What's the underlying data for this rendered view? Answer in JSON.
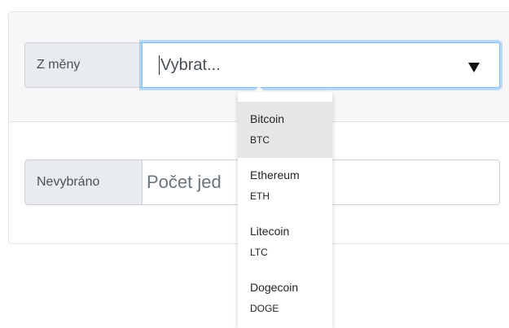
{
  "from_currency": {
    "label": "Z měny",
    "select_value": "Vybrat..."
  },
  "amount": {
    "label": "Nevybráno",
    "placeholder_visible": "Počet jed"
  },
  "dropdown": {
    "options": [
      {
        "name": "Bitcoin",
        "symbol": "BTC",
        "highlighted": true
      },
      {
        "name": "Ethereum",
        "symbol": "ETH",
        "highlighted": false
      },
      {
        "name": "Litecoin",
        "symbol": "LTC",
        "highlighted": false
      },
      {
        "name": "Dogecoin",
        "symbol": "DOGE",
        "highlighted": false
      }
    ]
  },
  "colors": {
    "focus_border": "#80bdff",
    "addon_bg": "#e9ecef",
    "header_bg": "#f7f7f7",
    "highlight_bg": "#e6e6e6"
  },
  "icons": {
    "select_arrow": "caret-down-icon"
  }
}
